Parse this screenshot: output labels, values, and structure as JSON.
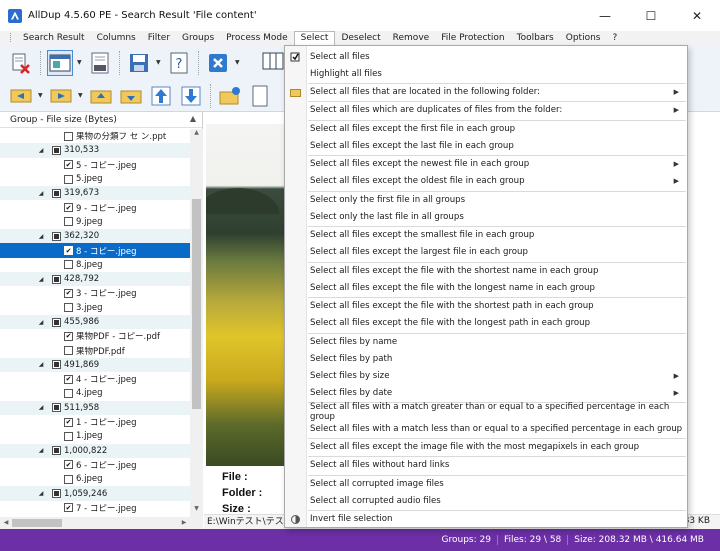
{
  "window": {
    "title": "AllDup 4.5.60 PE - Search Result 'File content'",
    "minimize": "—",
    "maximize": "☐",
    "close": "✕"
  },
  "menu": [
    "Search Result",
    "Columns",
    "Filter",
    "Groups",
    "Process Mode",
    "Select",
    "Deselect",
    "Remove",
    "File Protection",
    "Toolbars",
    "Options",
    "?"
  ],
  "left_panel": {
    "header": "Group - File size (Bytes)",
    "rows": [
      {
        "type": "file",
        "text": "果物の分類フ セ ン.ppt",
        "checked": false
      },
      {
        "type": "group",
        "text": "310,533"
      },
      {
        "type": "file",
        "text": "5 - コピー.jpeg",
        "checked": true
      },
      {
        "type": "file",
        "text": "5.jpeg",
        "checked": false
      },
      {
        "type": "group",
        "text": "319,673"
      },
      {
        "type": "file",
        "text": "9 - コピー.jpeg",
        "checked": true
      },
      {
        "type": "file",
        "text": "9.jpeg",
        "checked": false
      },
      {
        "type": "group",
        "text": "362,320"
      },
      {
        "type": "file",
        "text": "8 - コピー.jpeg",
        "checked": true,
        "selected": true
      },
      {
        "type": "file",
        "text": "8.jpeg",
        "checked": false
      },
      {
        "type": "group",
        "text": "428,792"
      },
      {
        "type": "file",
        "text": "3 - コピー.jpeg",
        "checked": true
      },
      {
        "type": "file",
        "text": "3.jpeg",
        "checked": false
      },
      {
        "type": "group",
        "text": "455,986"
      },
      {
        "type": "file",
        "text": "果物PDF - コピー.pdf",
        "checked": true
      },
      {
        "type": "file",
        "text": "果物PDF.pdf",
        "checked": false
      },
      {
        "type": "group",
        "text": "491,869"
      },
      {
        "type": "file",
        "text": "4 - コピー.jpeg",
        "checked": true
      },
      {
        "type": "file",
        "text": "4.jpeg",
        "checked": false
      },
      {
        "type": "group",
        "text": "511,958"
      },
      {
        "type": "file",
        "text": "1 - コピー.jpeg",
        "checked": true
      },
      {
        "type": "file",
        "text": "1.jpeg",
        "checked": false
      },
      {
        "type": "group",
        "text": "1,000,822"
      },
      {
        "type": "file",
        "text": "6 - コピー.jpeg",
        "checked": true
      },
      {
        "type": "file",
        "text": "6.jpeg",
        "checked": false
      },
      {
        "type": "group",
        "text": "1,059,246"
      },
      {
        "type": "file",
        "text": "7 - コピー.jpeg",
        "checked": true
      }
    ]
  },
  "preview": {
    "file_label": "File :",
    "folder_label": "Folder :",
    "size_label": "Size :",
    "path": "E:\\Winテスト\\テス",
    "size_fragment": "83 KB"
  },
  "status": {
    "groups": "Groups: 29",
    "files": "Files: 29 \\ 58",
    "size": "Size: 208.32 MB \\ 416.64 MB"
  },
  "select_menu": [
    {
      "label": "Select all files",
      "icon": true
    },
    {
      "label": "Highlight all files"
    },
    {
      "sep": true
    },
    {
      "label": "Select all files that are located in the following folder:",
      "submenu": true,
      "icon": true
    },
    {
      "sep": true
    },
    {
      "label": "Select all files which are duplicates of files from the folder:",
      "submenu": true
    },
    {
      "sep": true
    },
    {
      "label": "Select all files except the first file in each group"
    },
    {
      "label": "Select all files except the last file in each group"
    },
    {
      "sep": true
    },
    {
      "label": "Select all files except the newest file in each group",
      "submenu": true
    },
    {
      "label": "Select all files except the oldest file in each group",
      "submenu": true
    },
    {
      "sep": true
    },
    {
      "label": "Select only the first file in all groups"
    },
    {
      "label": "Select only the last file in all groups"
    },
    {
      "sep": true
    },
    {
      "label": "Select all files except the smallest file in each group"
    },
    {
      "label": "Select all files except the largest file in each group"
    },
    {
      "sep": true
    },
    {
      "label": "Select all files except the file with the shortest name in each group"
    },
    {
      "label": "Select all files except the file with the longest name in each group"
    },
    {
      "sep": true
    },
    {
      "label": "Select all files except the file with the shortest path in each group"
    },
    {
      "label": "Select all files except the file with the longest path in each group"
    },
    {
      "sep": true
    },
    {
      "label": "Select files by name"
    },
    {
      "label": "Select files by path"
    },
    {
      "label": "Select files by size",
      "submenu": true
    },
    {
      "label": "Select files by date",
      "submenu": true
    },
    {
      "sep": true
    },
    {
      "label": "Select all files with a match greater than or equal to a specified percentage in each group"
    },
    {
      "label": "Select all files with a match less than or equal to a specified percentage in each group"
    },
    {
      "sep": true
    },
    {
      "label": "Select all files except the image file with the most megapixels in each group"
    },
    {
      "sep": true
    },
    {
      "label": "Select all files without hard links"
    },
    {
      "sep": true
    },
    {
      "label": "Select all corrupted image files"
    },
    {
      "label": "Select all corrupted audio files"
    },
    {
      "sep": true
    },
    {
      "label": "Invert file selection",
      "icon": true
    }
  ],
  "colors": {
    "status_bar": "#6c2fa6",
    "selection": "#0a6ac8",
    "group_row": "#eaf4f6"
  }
}
